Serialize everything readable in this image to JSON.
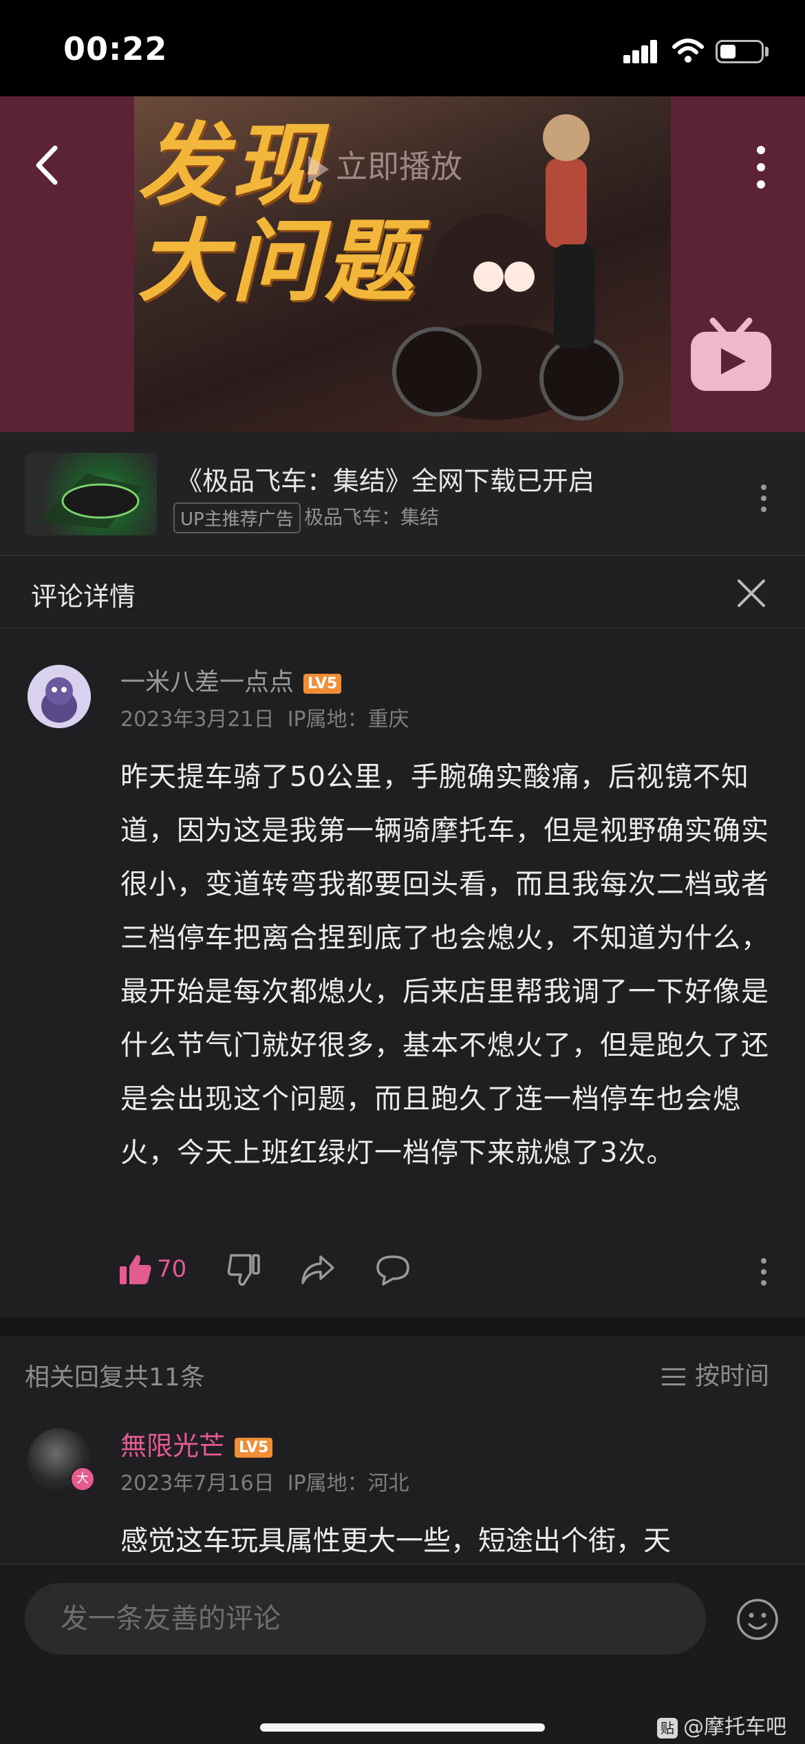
{
  "status_bar": {
    "time": "00:22"
  },
  "video": {
    "title_line1": "发现",
    "title_line2": "大问题",
    "play_now": "立即播放"
  },
  "ad": {
    "title": "《极品飞车：集结》全网下载已开启",
    "badge": "UP主推荐广告",
    "source": "极品飞车：集结"
  },
  "detail": {
    "title": "评论详情"
  },
  "comment": {
    "username": "一米八差一点点",
    "level": "LV5",
    "date": "2023年3月21日",
    "ip": "IP属地：重庆",
    "text": "昨天提车骑了50公里，手腕确实酸痛，后视镜不知道，因为这是我第一辆骑摩托车，但是视野确实确实很小，变道转弯我都要回头看，而且我每次二档或者三档停车把离合捏到底了也会熄火，不知道为什么，最开始是每次都熄火，后来店里帮我调了一下好像是什么节气门就好很多，基本不熄火了，但是跑久了还是会出现这个问题，而且跑久了连一档停车也会熄火，今天上班红绿灯一档停下来就熄了3次。",
    "like_count": "70"
  },
  "replies": {
    "count_label": "相关回复共11条",
    "sort_label": "按时间",
    "items": [
      {
        "username": "無限光芒",
        "level": "LV5",
        "badge": "大",
        "date": "2023年7月16日",
        "ip": "IP属地：河北",
        "text": "感觉这车玩具属性更大一些，短途出个街，天"
      }
    ]
  },
  "input": {
    "placeholder": "发一条友善的评论"
  },
  "watermark": {
    "logo": "贴",
    "text": "@摩托车吧"
  },
  "colors": {
    "accent_pink": "#e35b8f",
    "level_orange": "#f08e35",
    "banner_bg": "#5b2333",
    "title_yellow": "#f2b63a"
  }
}
